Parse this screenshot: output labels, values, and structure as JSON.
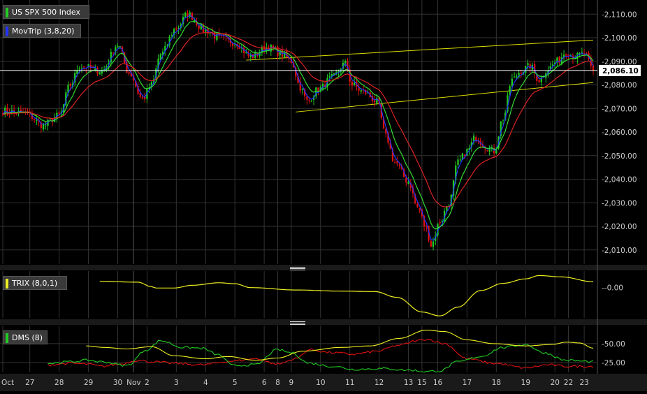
{
  "legends": {
    "price": "US SPX 500 Index",
    "movtrip": "MovTrip (3,8,20)",
    "trix": "TRIX (8,0,1)",
    "dms": "DMS (8)"
  },
  "current_price_label": "2,086.10",
  "colors": {
    "background": "#000000",
    "grid": "#333333",
    "up": "#22cc22",
    "down": "#dd1111",
    "ma3": "#2233ff",
    "ma8": "#33dd33",
    "ma20": "#dd2222",
    "trendline": "#dddd00",
    "trix": "#eeee22",
    "dms_plus": "#22cc22",
    "dms_minus": "#dd1111",
    "adx": "#eeee22",
    "price_line": "#ffffff"
  },
  "icons": {
    "price_swatch": "green-bar",
    "movtrip_swatch": "blue-bar",
    "trix_swatch": "yellow-bar",
    "dms_swatch": "green-bar",
    "pane_divider": "grip-lines-icon"
  },
  "chart_data": {
    "type": "candlestick",
    "price_axis": {
      "ylim": [
        2004,
        2116
      ],
      "ticks": [
        2010,
        2020,
        2030,
        2040,
        2050,
        2060,
        2070,
        2080,
        2090,
        2100,
        2110
      ],
      "tick_labels": [
        "2,010.00",
        "2,020.00",
        "2,030.00",
        "2,040.00",
        "2,050.00",
        "2,060.00",
        "2,070.00",
        "2,080.00",
        "2,090.00",
        "2,100.00",
        "2,110.00"
      ]
    },
    "x_axis": {
      "labels": [
        {
          "text": "Oct",
          "index": 0
        },
        {
          "text": "27",
          "index": 12
        },
        {
          "text": "28",
          "index": 25
        },
        {
          "text": "29",
          "index": 38
        },
        {
          "text": "30",
          "index": 51
        },
        {
          "text": "Nov",
          "index": 58
        },
        {
          "text": "2",
          "index": 64
        },
        {
          "text": "3",
          "index": 77
        },
        {
          "text": "4",
          "index": 90
        },
        {
          "text": "5",
          "index": 103
        },
        {
          "text": "6",
          "index": 116
        },
        {
          "text": "8",
          "index": 122
        },
        {
          "text": "9",
          "index": 128
        },
        {
          "text": "10",
          "index": 141
        },
        {
          "text": "11",
          "index": 154
        },
        {
          "text": "12",
          "index": 167
        },
        {
          "text": "13",
          "index": 180
        },
        {
          "text": "15",
          "index": 186
        },
        {
          "text": "16",
          "index": 193
        },
        {
          "text": "17",
          "index": 206
        },
        {
          "text": "18",
          "index": 219
        },
        {
          "text": "19",
          "index": 232
        },
        {
          "text": "20",
          "index": 245
        },
        {
          "text": "22",
          "index": 251
        },
        {
          "text": "23",
          "index": 258
        }
      ]
    },
    "current_price": 2086.1,
    "close_anchors": [
      [
        0,
        2069
      ],
      [
        10,
        2068
      ],
      [
        18,
        2063
      ],
      [
        25,
        2067
      ],
      [
        30,
        2080
      ],
      [
        34,
        2088
      ],
      [
        44,
        2086
      ],
      [
        51,
        2097
      ],
      [
        56,
        2085
      ],
      [
        62,
        2074
      ],
      [
        66,
        2080
      ],
      [
        70,
        2093
      ],
      [
        77,
        2104
      ],
      [
        82,
        2110
      ],
      [
        90,
        2103
      ],
      [
        96,
        2100
      ],
      [
        103,
        2098
      ],
      [
        110,
        2092
      ],
      [
        118,
        2096
      ],
      [
        124,
        2093
      ],
      [
        128,
        2090
      ],
      [
        132,
        2079
      ],
      [
        135,
        2073
      ],
      [
        140,
        2078
      ],
      [
        146,
        2083
      ],
      [
        152,
        2089
      ],
      [
        155,
        2080
      ],
      [
        160,
        2077
      ],
      [
        166,
        2073
      ],
      [
        170,
        2058
      ],
      [
        174,
        2047
      ],
      [
        180,
        2039
      ],
      [
        184,
        2028
      ],
      [
        188,
        2019
      ],
      [
        190,
        2012
      ],
      [
        194,
        2022
      ],
      [
        198,
        2030
      ],
      [
        202,
        2047
      ],
      [
        206,
        2052
      ],
      [
        210,
        2058
      ],
      [
        214,
        2054
      ],
      [
        218,
        2052
      ],
      [
        222,
        2066
      ],
      [
        226,
        2082
      ],
      [
        230,
        2086
      ],
      [
        234,
        2088
      ],
      [
        238,
        2082
      ],
      [
        242,
        2087
      ],
      [
        246,
        2090
      ],
      [
        250,
        2094
      ],
      [
        254,
        2092
      ],
      [
        258,
        2093
      ],
      [
        262,
        2086.1
      ]
    ],
    "candle_count": 263,
    "series": [
      {
        "name": "MovTrip (3,8,20)",
        "periods": [
          3,
          8,
          20
        ]
      }
    ],
    "channel_lines": [
      {
        "from": [
          108,
          2090.5
        ],
        "to": [
          262,
          2099
        ]
      },
      {
        "from": [
          130,
          2068.5
        ],
        "to": [
          262,
          2081
        ]
      }
    ],
    "trix": {
      "name": "TRIX (8,0,1)",
      "ylim": [
        -1.55,
        0.85
      ],
      "tick_labels": [
        "-0.00"
      ],
      "ticks": [
        0
      ],
      "anchors": [
        [
          43,
          0.32
        ],
        [
          60,
          0.28
        ],
        [
          66,
          0.05
        ],
        [
          68,
          -0.02
        ],
        [
          76,
          -0.02
        ],
        [
          84,
          0.12
        ],
        [
          96,
          0.25
        ],
        [
          103,
          0.2
        ],
        [
          110,
          0.0
        ],
        [
          130,
          -0.12
        ],
        [
          150,
          -0.18
        ],
        [
          165,
          -0.2
        ],
        [
          175,
          -0.5
        ],
        [
          186,
          -1.25
        ],
        [
          194,
          -1.45
        ],
        [
          202,
          -1.0
        ],
        [
          212,
          -0.15
        ],
        [
          222,
          0.22
        ],
        [
          232,
          0.45
        ],
        [
          238,
          0.62
        ],
        [
          248,
          0.55
        ],
        [
          262,
          0.3
        ]
      ]
    },
    "dms": {
      "name": "DMS (8)",
      "ylim": [
        12,
        74
      ],
      "ticks": [
        25,
        50
      ],
      "tick_labels": [
        "25.00",
        "50.00"
      ],
      "adx": [
        [
          37,
          47
        ],
        [
          45,
          45
        ],
        [
          55,
          43
        ],
        [
          66,
          46
        ],
        [
          76,
          34
        ],
        [
          90,
          30
        ],
        [
          100,
          33
        ],
        [
          112,
          28
        ],
        [
          122,
          31
        ],
        [
          133,
          40
        ],
        [
          150,
          45
        ],
        [
          163,
          47
        ],
        [
          176,
          57
        ],
        [
          188,
          68
        ],
        [
          196,
          66
        ],
        [
          206,
          55
        ],
        [
          218,
          50
        ],
        [
          232,
          47
        ],
        [
          244,
          49
        ],
        [
          250,
          52
        ],
        [
          256,
          51
        ],
        [
          262,
          44
        ]
      ],
      "dm_plus": [
        [
          20,
          24
        ],
        [
          30,
          26
        ],
        [
          37,
          28
        ],
        [
          44,
          26
        ],
        [
          55,
          21
        ],
        [
          64,
          42
        ],
        [
          70,
          54
        ],
        [
          80,
          45
        ],
        [
          88,
          44
        ],
        [
          96,
          35
        ],
        [
          102,
          21
        ],
        [
          112,
          22
        ],
        [
          122,
          42
        ],
        [
          128,
          38
        ],
        [
          136,
          24
        ],
        [
          146,
          20
        ],
        [
          156,
          16
        ],
        [
          168,
          17
        ],
        [
          180,
          15
        ],
        [
          188,
          13
        ],
        [
          194,
          14
        ],
        [
          202,
          26
        ],
        [
          212,
          33
        ],
        [
          222,
          45
        ],
        [
          232,
          49
        ],
        [
          240,
          38
        ],
        [
          250,
          28
        ],
        [
          262,
          26
        ]
      ],
      "dm_minus": [
        [
          20,
          22
        ],
        [
          30,
          24
        ],
        [
          37,
          23
        ],
        [
          44,
          20
        ],
        [
          52,
          23
        ],
        [
          60,
          28
        ],
        [
          66,
          26
        ],
        [
          76,
          24
        ],
        [
          88,
          22
        ],
        [
          102,
          27
        ],
        [
          112,
          30
        ],
        [
          122,
          23
        ],
        [
          130,
          30
        ],
        [
          136,
          42
        ],
        [
          146,
          38
        ],
        [
          156,
          36
        ],
        [
          166,
          40
        ],
        [
          176,
          48
        ],
        [
          184,
          54
        ],
        [
          188,
          56
        ],
        [
          196,
          50
        ],
        [
          206,
          30
        ],
        [
          218,
          24
        ],
        [
          232,
          18
        ],
        [
          242,
          22
        ],
        [
          250,
          20
        ],
        [
          262,
          20
        ]
      ]
    }
  }
}
